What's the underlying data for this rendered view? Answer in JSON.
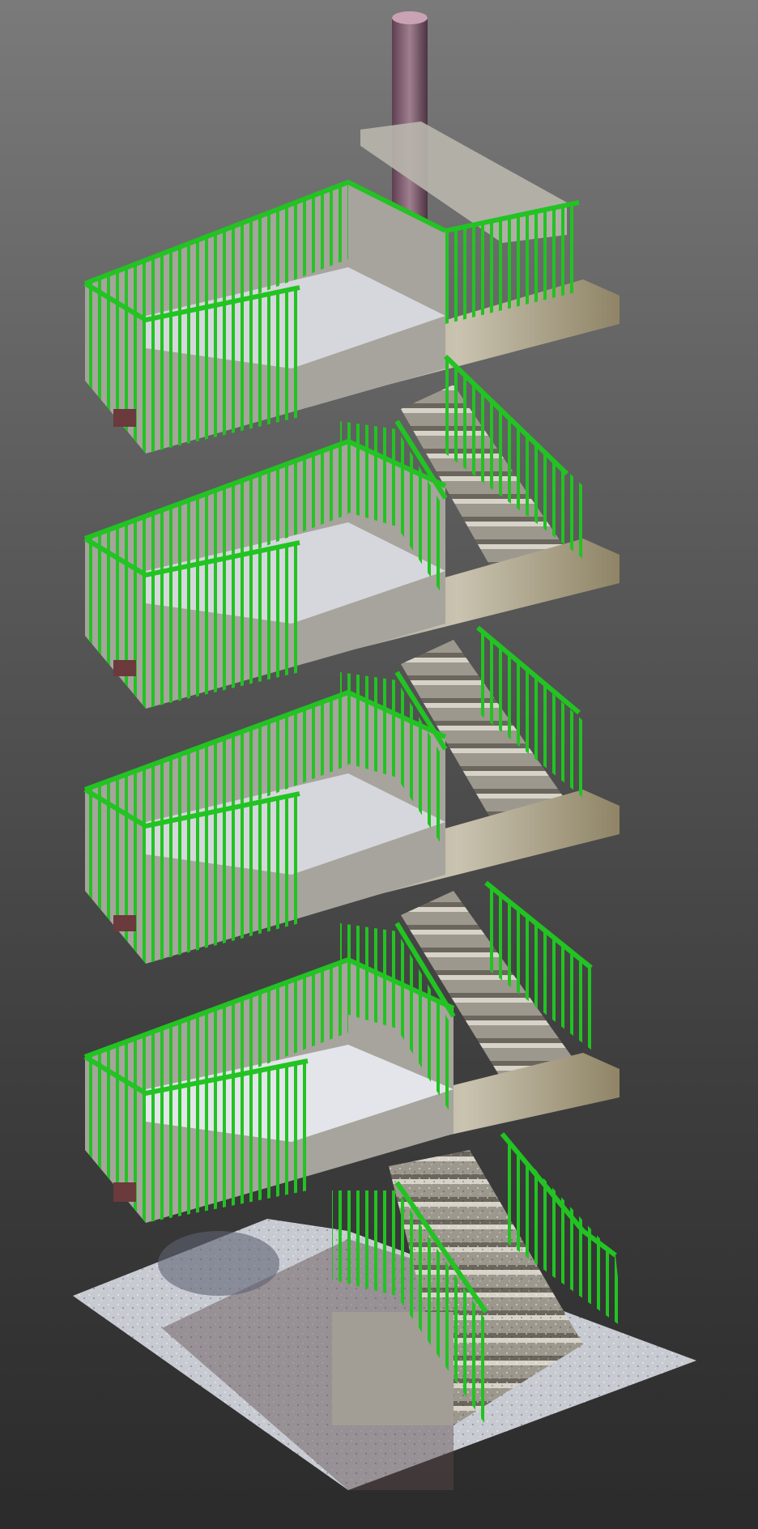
{
  "scene": {
    "type": "point-cloud-render",
    "subject": "multi-storey-staircase",
    "floors": 4,
    "colors": {
      "railing": "#22c322",
      "railing_dark": "#138a13",
      "concrete": "#a6a29a",
      "concrete_dark": "#6f6a62",
      "pipe": "#7c5a6c",
      "ground": "#c9cbd2"
    }
  }
}
